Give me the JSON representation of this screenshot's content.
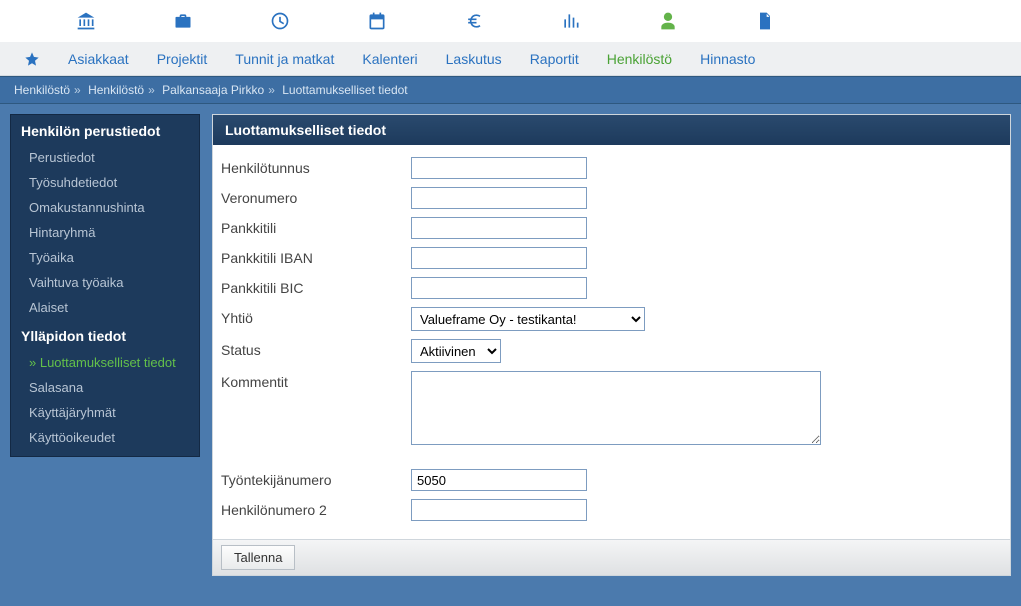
{
  "top_icons": [
    "bank",
    "briefcase",
    "clock",
    "calendar",
    "euro",
    "bar-chart",
    "user",
    "file"
  ],
  "active_top_icon_index": 6,
  "main_nav": {
    "items": [
      "Asiakkaat",
      "Projektit",
      "Tunnit ja matkat",
      "Kalenteri",
      "Laskutus",
      "Raportit",
      "Henkilöstö",
      "Hinnasto"
    ],
    "active_index": 6
  },
  "breadcrumb": [
    "Henkilöstö",
    "Henkilöstö",
    "Palkansaaja Pirkko",
    "Luottamukselliset tiedot"
  ],
  "sidebar": {
    "sections": [
      {
        "title": "Henkilön perustiedot",
        "items": [
          "Perustiedot",
          "Työsuhdetiedot",
          "Omakustannushinta",
          "Hintaryhmä",
          "Työaika",
          "Vaihtuva työaika",
          "Alaiset"
        ],
        "active_index": -1
      },
      {
        "title": "Ylläpidon tiedot",
        "items": [
          "Luottamukselliset tiedot",
          "Salasana",
          "Käyttäjäryhmät",
          "Käyttöoikeudet"
        ],
        "active_index": 0
      }
    ]
  },
  "panel": {
    "title": "Luottamukselliset tiedot",
    "fields": {
      "henkilotunnus": {
        "label": "Henkilötunnus",
        "value": ""
      },
      "veronumero": {
        "label": "Veronumero",
        "value": ""
      },
      "pankkitili": {
        "label": "Pankkitili",
        "value": ""
      },
      "iban": {
        "label": "Pankkitili IBAN",
        "value": ""
      },
      "bic": {
        "label": "Pankkitili BIC",
        "value": ""
      },
      "yhtio": {
        "label": "Yhtiö",
        "selected": "Valueframe Oy - testikanta!"
      },
      "status": {
        "label": "Status",
        "selected": "Aktiivinen"
      },
      "kommentit": {
        "label": "Kommentit",
        "value": ""
      },
      "tyontekijanum": {
        "label": "Työntekijänumero",
        "value": "5050"
      },
      "henkilonum2": {
        "label": "Henkilönumero 2",
        "value": ""
      }
    },
    "save_label": "Tallenna"
  }
}
